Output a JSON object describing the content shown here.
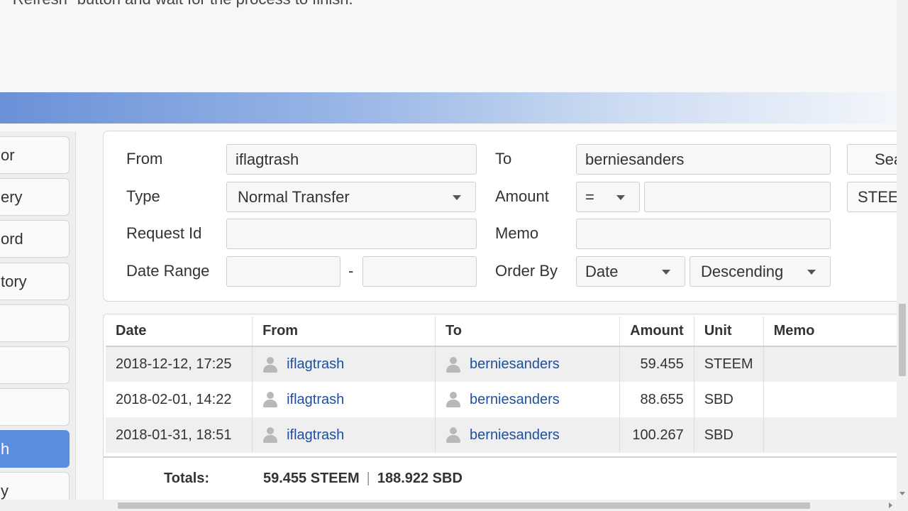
{
  "intro_text": "\"Refresh\" button and wait for the process to finish.",
  "sidebar": {
    "items": [
      {
        "label": "or"
      },
      {
        "label": "ery"
      },
      {
        "label": "ord"
      },
      {
        "label": "tory"
      },
      {
        "label": ""
      },
      {
        "label": ""
      },
      {
        "label": ""
      },
      {
        "label": "h"
      },
      {
        "label": "y"
      }
    ]
  },
  "form": {
    "from_label": "From",
    "from_value": "iflagtrash",
    "to_label": "To",
    "to_value": "berniesanders",
    "search_button": "Search",
    "type_label": "Type",
    "type_value": "Normal Transfer",
    "amount_label": "Amount",
    "amount_op": "=",
    "amount_value": "",
    "unit_value": "STEEM",
    "request_id_label": "Request Id",
    "request_id_value": "",
    "memo_label": "Memo",
    "memo_value": "",
    "date_range_label": "Date Range",
    "date_from": "",
    "date_sep": "-",
    "date_to": "",
    "order_by_label": "Order By",
    "order_by_value": "Date",
    "order_dir_value": "Descending"
  },
  "table": {
    "headers": [
      "Date",
      "From",
      "To",
      "Amount",
      "Unit",
      "Memo"
    ],
    "rows": [
      {
        "date": "2018-12-12, 17:25",
        "from": "iflagtrash",
        "to": "berniesanders",
        "amount": "59.455",
        "unit": "STEEM",
        "memo": ""
      },
      {
        "date": "2018-02-01, 14:22",
        "from": "iflagtrash",
        "to": "berniesanders",
        "amount": "88.655",
        "unit": "SBD",
        "memo": ""
      },
      {
        "date": "2018-01-31, 18:51",
        "from": "iflagtrash",
        "to": "berniesanders",
        "amount": "100.267",
        "unit": "SBD",
        "memo": ""
      }
    ]
  },
  "totals": {
    "label": "Totals:",
    "steem": "59.455 STEEM",
    "separator": "|",
    "sbd": "188.922 SBD"
  }
}
